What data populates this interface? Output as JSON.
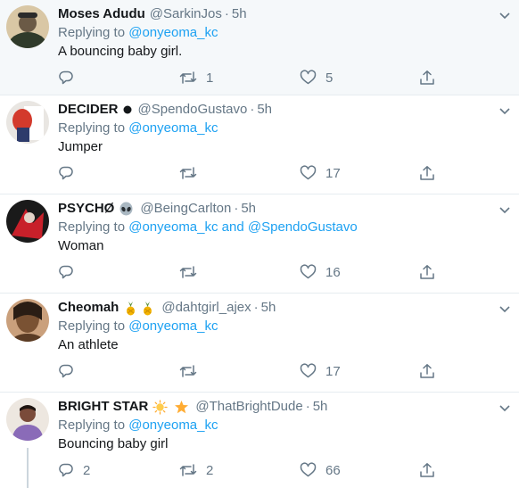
{
  "reply_prefix": "Replying to ",
  "reply_joiner": " and ",
  "tweets": [
    {
      "name": "Moses Adudu",
      "emojis": [],
      "handle": "@SarkinJos",
      "time": "5h",
      "mentions": [
        "@onyeoma_kc"
      ],
      "text": "A bouncing baby girl.",
      "replies": "",
      "retweets": "1",
      "likes": "5",
      "avatar_colors": [
        "#6b5a46",
        "#d9c7a5"
      ]
    },
    {
      "name": "DECIDER",
      "emojis": [
        "black-circle"
      ],
      "handle": "@SpendoGustavo",
      "time": "5h",
      "mentions": [
        "@onyeoma_kc"
      ],
      "text": "Jumper",
      "replies": "",
      "retweets": "",
      "likes": "17",
      "avatar_colors": [
        "#d33a2c",
        "#e9e6e2"
      ]
    },
    {
      "name": "PSYCHØ",
      "emojis": [
        "alien"
      ],
      "handle": "@BeingCarlton",
      "time": "5h",
      "mentions": [
        "@onyeoma_kc",
        "@SpendoGustavo"
      ],
      "text": "Woman",
      "replies": "",
      "retweets": "",
      "likes": "16",
      "avatar_colors": [
        "#1a1a1a",
        "#c8202a"
      ]
    },
    {
      "name": "Cheomah",
      "emojis": [
        "pineapple",
        "pineapple"
      ],
      "handle": "@dahtgirl_ajex",
      "time": "5h",
      "mentions": [
        "@onyeoma_kc"
      ],
      "text": "An athlete",
      "replies": "",
      "retweets": "",
      "likes": "17",
      "avatar_colors": [
        "#7a5233",
        "#caa07c"
      ]
    },
    {
      "name": "BRIGHT STAR",
      "emojis": [
        "sun-behind-cloud",
        "star"
      ],
      "handle": "@ThatBrightDude",
      "time": "5h",
      "mentions": [
        "@onyeoma_kc"
      ],
      "text": "Bouncing baby girl",
      "replies": "2",
      "retweets": "2",
      "likes": "66",
      "avatar_colors": [
        "#7a4b3a",
        "#8a6bb8"
      ]
    }
  ],
  "colors": {
    "link": "#1da1f2",
    "secondary_text": "#657786",
    "divider": "#e6ecf0",
    "highlight_bg": "#f5f8fa"
  }
}
